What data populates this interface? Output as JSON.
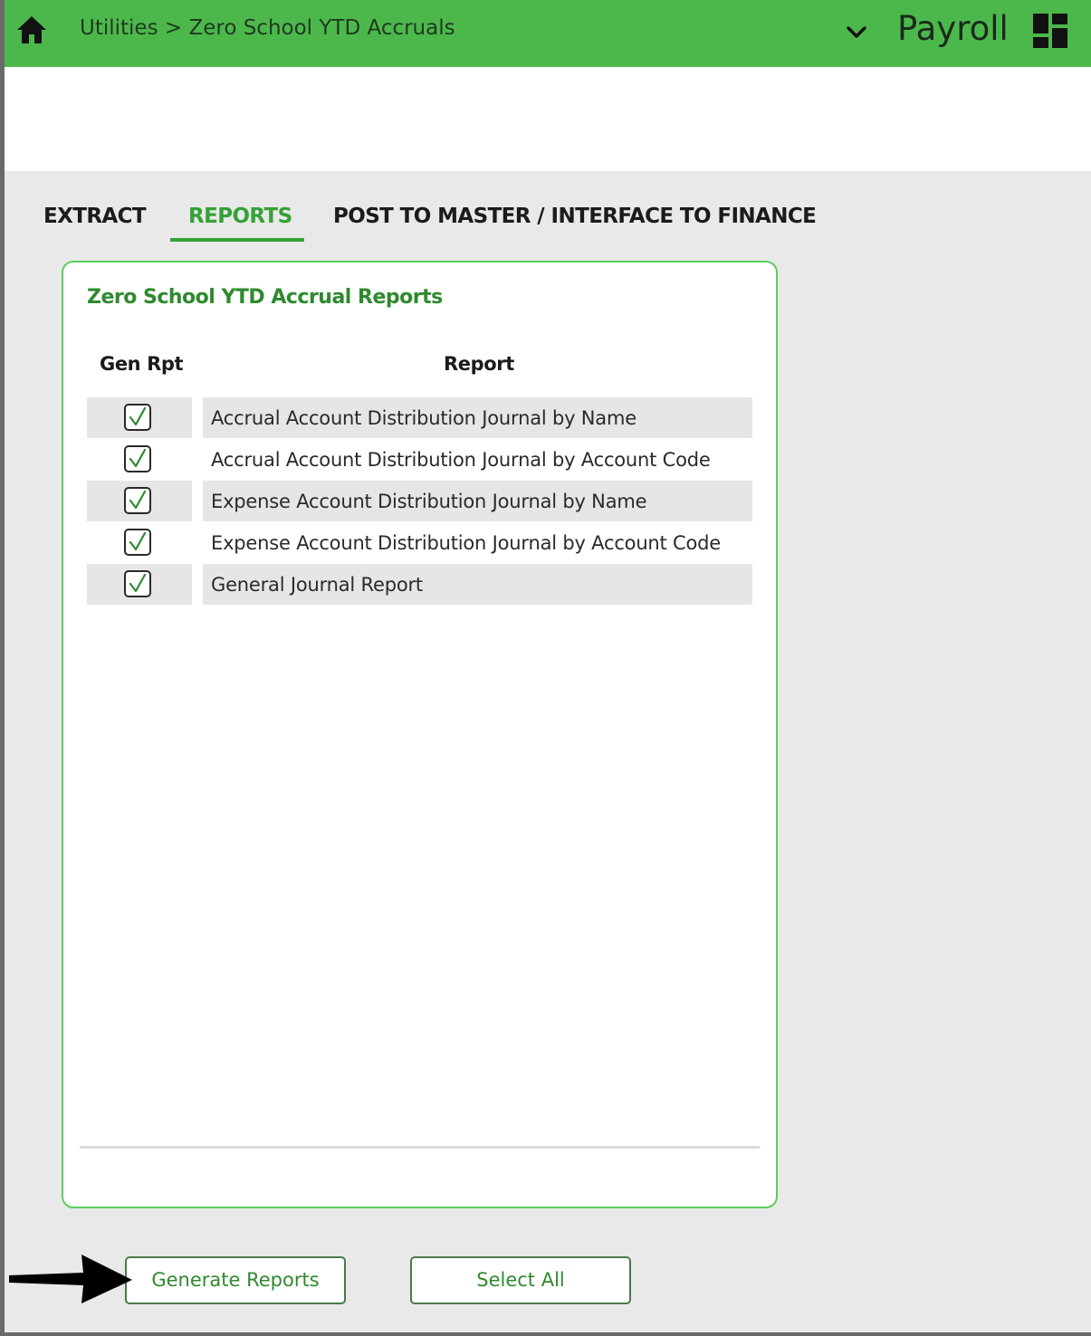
{
  "header": {
    "breadcrumb": "Utilities > Zero School YTD Accruals",
    "app_name": "Payroll",
    "home_icon": "home-icon",
    "dropdown_icon": "chevron-down-icon",
    "app_menu_icon": "grid-icon"
  },
  "tabs": [
    {
      "label": "EXTRACT",
      "active": false
    },
    {
      "label": "REPORTS",
      "active": true
    },
    {
      "label": "POST TO MASTER / INTERFACE TO FINANCE",
      "active": false
    }
  ],
  "panel": {
    "title": "Zero School YTD Accrual Reports",
    "columns": [
      "Gen Rpt",
      "Report"
    ],
    "rows": [
      {
        "checked": true,
        "report": "Accrual Account Distribution Journal by Name"
      },
      {
        "checked": true,
        "report": "Accrual Account Distribution Journal by Account Code"
      },
      {
        "checked": true,
        "report": "Expense Account Distribution Journal by Name"
      },
      {
        "checked": true,
        "report": "Expense Account Distribution Journal by Account Code"
      },
      {
        "checked": true,
        "report": "General Journal Report"
      }
    ]
  },
  "buttons": {
    "generate_label": "Generate Reports",
    "select_all_label": "Select All"
  },
  "annotation": {
    "pointer_icon": "arrow-right-icon"
  },
  "colors": {
    "header_green": "#4cb84c",
    "accent_green": "#36a136",
    "panel_border": "#5ccc5c",
    "background": "#e9e9e9"
  }
}
